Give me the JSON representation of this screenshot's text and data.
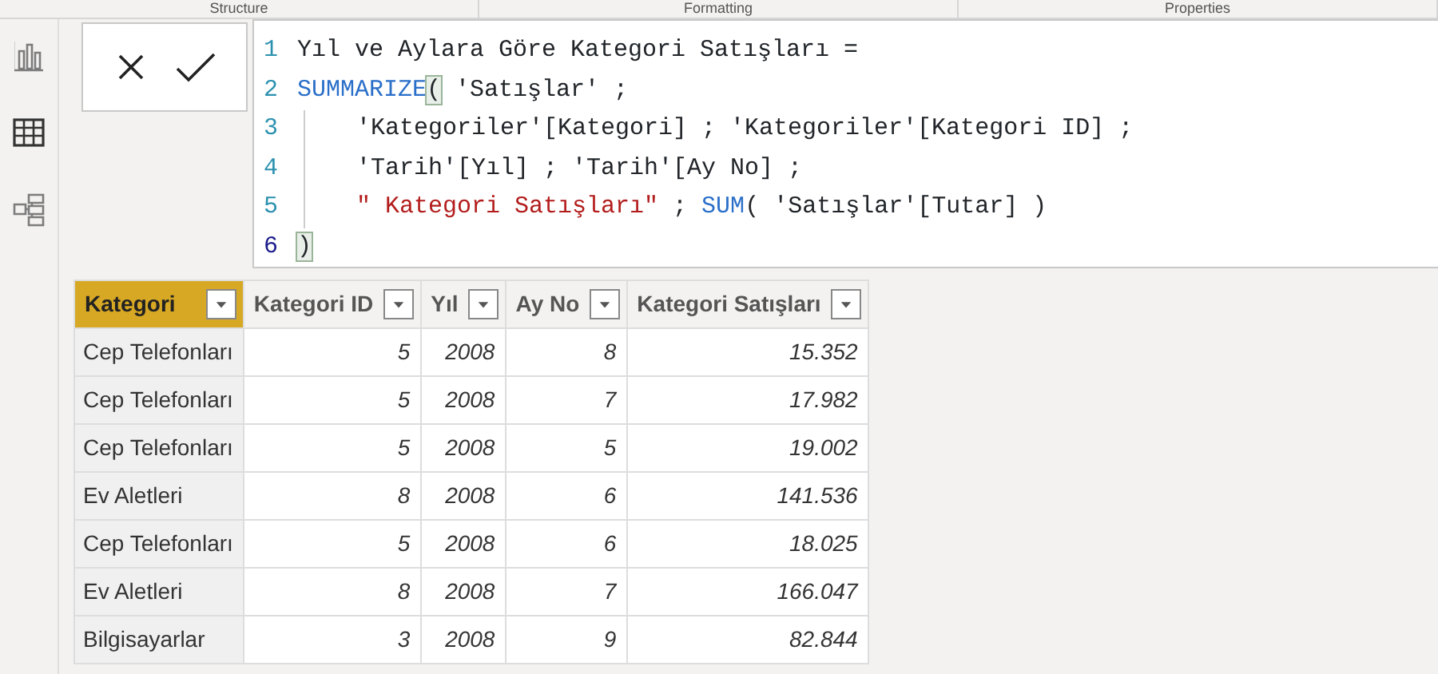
{
  "ribbon": {
    "groups": [
      "Structure",
      "Formatting",
      "Properties"
    ]
  },
  "sidebar": {
    "items": [
      {
        "kind": "report",
        "selected": false
      },
      {
        "kind": "data",
        "selected": true
      },
      {
        "kind": "model",
        "selected": false
      }
    ]
  },
  "formula_bar": {
    "lines": [
      {
        "number": "1",
        "indented": false,
        "tokens": [
          {
            "kind": "plain",
            "text": "Yıl ve Aylara Göre Kategori Satışları ="
          }
        ]
      },
      {
        "number": "2",
        "indented": false,
        "tokens": [
          {
            "kind": "keyword",
            "text": "SUMMARIZE"
          },
          {
            "kind": "match",
            "text": "("
          },
          {
            "kind": "plain",
            "text": " 'Satışlar' ;"
          }
        ]
      },
      {
        "number": "3",
        "indented": true,
        "tokens": [
          {
            "kind": "plain",
            "text": "'Kategoriler'[Kategori] ; 'Kategoriler'[Kategori ID] ;"
          }
        ]
      },
      {
        "number": "4",
        "indented": true,
        "tokens": [
          {
            "kind": "plain",
            "text": "'Tarih'[Yıl] ; 'Tarih'[Ay No] ;"
          }
        ]
      },
      {
        "number": "5",
        "indented": true,
        "tokens": [
          {
            "kind": "string",
            "text": "\" Kategori Satışları\""
          },
          {
            "kind": "plain",
            "text": " ; "
          },
          {
            "kind": "keyword",
            "text": "SUM"
          },
          {
            "kind": "plain",
            "text": "( 'Satışlar'[Tutar] )"
          }
        ]
      },
      {
        "number": "6",
        "indented": false,
        "tokens": [
          {
            "kind": "match",
            "text": ")"
          }
        ]
      }
    ]
  },
  "table": {
    "columns": [
      {
        "label": "Kategori",
        "selected": true
      },
      {
        "label": "Kategori ID",
        "selected": false
      },
      {
        "label": "Yıl",
        "selected": false
      },
      {
        "label": "Ay No",
        "selected": false
      },
      {
        "label": "Kategori Satışları",
        "selected": false
      }
    ],
    "rows": [
      [
        "Cep Telefonları",
        "5",
        "2008",
        "8",
        "15.352"
      ],
      [
        "Cep Telefonları",
        "5",
        "2008",
        "7",
        "17.982"
      ],
      [
        "Cep Telefonları",
        "5",
        "2008",
        "5",
        "19.002"
      ],
      [
        "Ev Aletleri",
        "8",
        "2008",
        "6",
        "141.536"
      ],
      [
        "Cep Telefonları",
        "5",
        "2008",
        "6",
        "18.025"
      ],
      [
        "Ev Aletleri",
        "8",
        "2008",
        "7",
        "166.047"
      ],
      [
        "Bilgisayarlar",
        "3",
        "2008",
        "9",
        "82.844"
      ]
    ]
  }
}
